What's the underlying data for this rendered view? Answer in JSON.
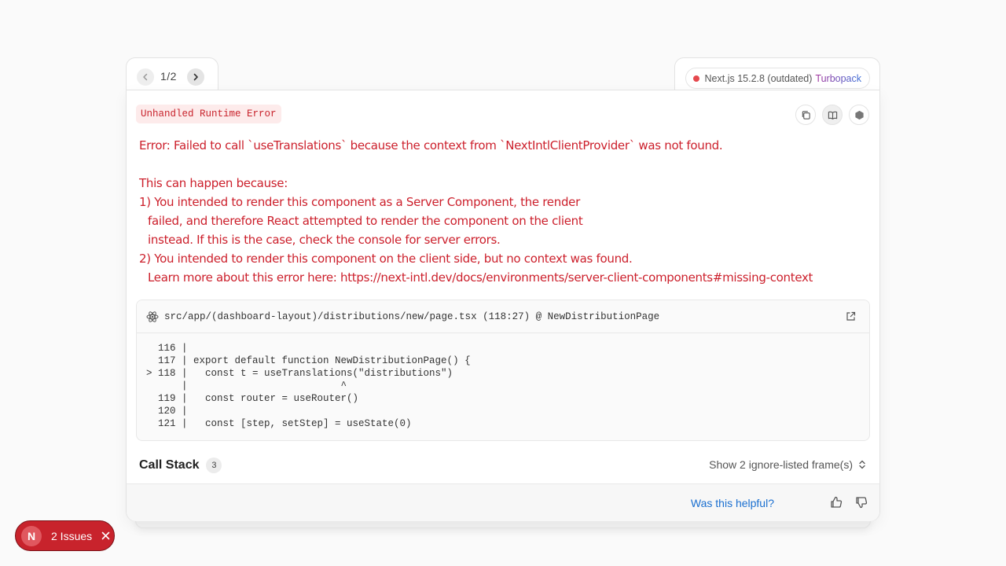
{
  "nav": {
    "page_indicator": "1/2"
  },
  "version": {
    "label": "Next.js 15.2.8 (outdated)",
    "bundler": "Turbopack"
  },
  "error": {
    "type_badge": "Unhandled Runtime Error",
    "message_lines": [
      "Error: Failed to call `useTranslations` because the context from `NextIntlClientProvider` was not found.",
      "",
      "This can happen because:",
      "1) You intended to render this component as a Server Component, the render",
      "failed, and therefore React attempted to render the component on the client",
      "instead. If this is the case, check the console for server errors.",
      "2) You intended to render this component on the client side, but no context was found.",
      "Learn more about this error here: https://next-intl.dev/docs/environments/server-client-components#missing-context"
    ]
  },
  "code_frame": {
    "path": "src/app/(dashboard-layout)/distributions/new/page.tsx (118:27) @ NewDistributionPage",
    "lines": [
      "  116 |",
      "  117 | export default function NewDistributionPage() {",
      "> 118 |   const t = useTranslations(\"distributions\")",
      "      |                          ^",
      "  119 |   const router = useRouter()",
      "  120 |",
      "  121 |   const [step, setStep] = useState(0)"
    ]
  },
  "call_stack": {
    "title": "Call Stack",
    "count": "3",
    "ignore_label": "Show 2 ignore-listed frame(s)"
  },
  "feedback": {
    "label": "Was this helpful?"
  },
  "issues_badge": {
    "logo": "N",
    "label": "2 Issues"
  },
  "colors": {
    "error_red": "#cc1f2b",
    "link_blue": "#1a6fd0",
    "badge_bg": "#c8232c"
  }
}
